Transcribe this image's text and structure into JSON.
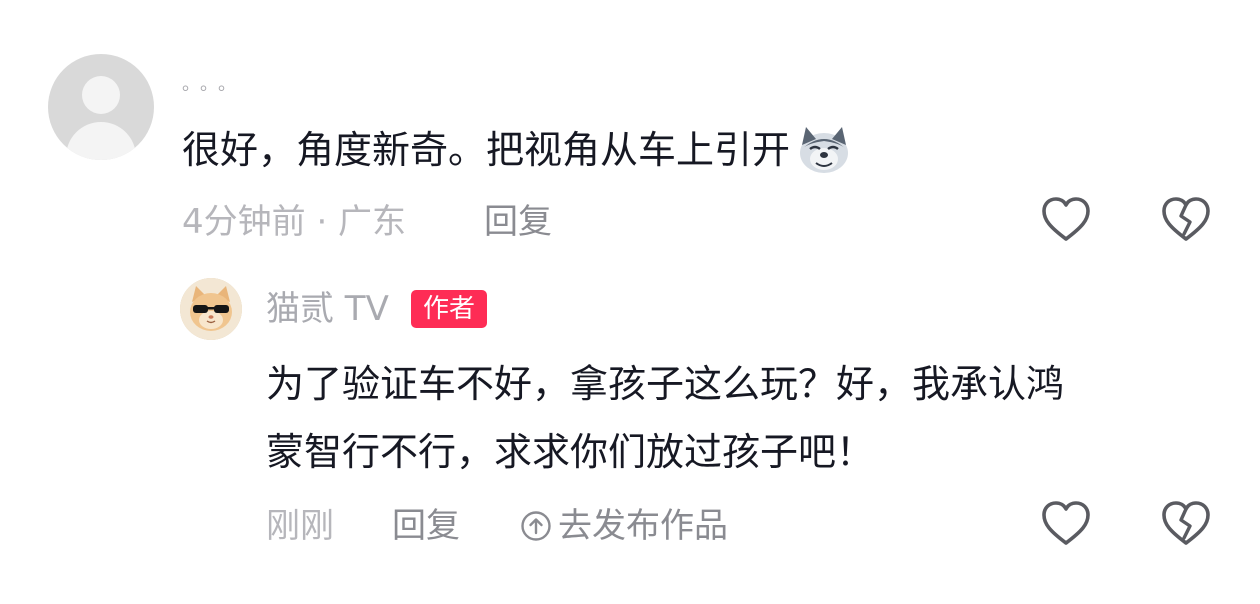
{
  "comment": {
    "username": "。。。",
    "text": "很好，角度新奇。把视角从车上引开",
    "emoji_icon": "doge-emoji-icon",
    "time_location": "4分钟前 · 广东",
    "reply_label": "回复",
    "like_icon": "heart-outline-icon",
    "dislike_icon": "broken-heart-icon"
  },
  "author_reply": {
    "username": "猫贰 TV",
    "badge": "作者",
    "text_line1": "为了验证车不好，拿孩子这么玩？好，我承认鸿",
    "text_line2": "蒙智行不行，求求你们放过孩子吧！",
    "time": "刚刚",
    "reply_label": "回复",
    "publish_label": "去发布作品",
    "publish_icon": "arrow-up-circle-icon",
    "like_icon": "heart-outline-icon",
    "dislike_icon": "broken-heart-icon"
  },
  "colors": {
    "text_primary": "#161823",
    "text_muted": "#b6b6bb",
    "text_action": "#8a8b91",
    "badge_bg": "#fe2c55",
    "icon_stroke": "#5a5b61"
  }
}
